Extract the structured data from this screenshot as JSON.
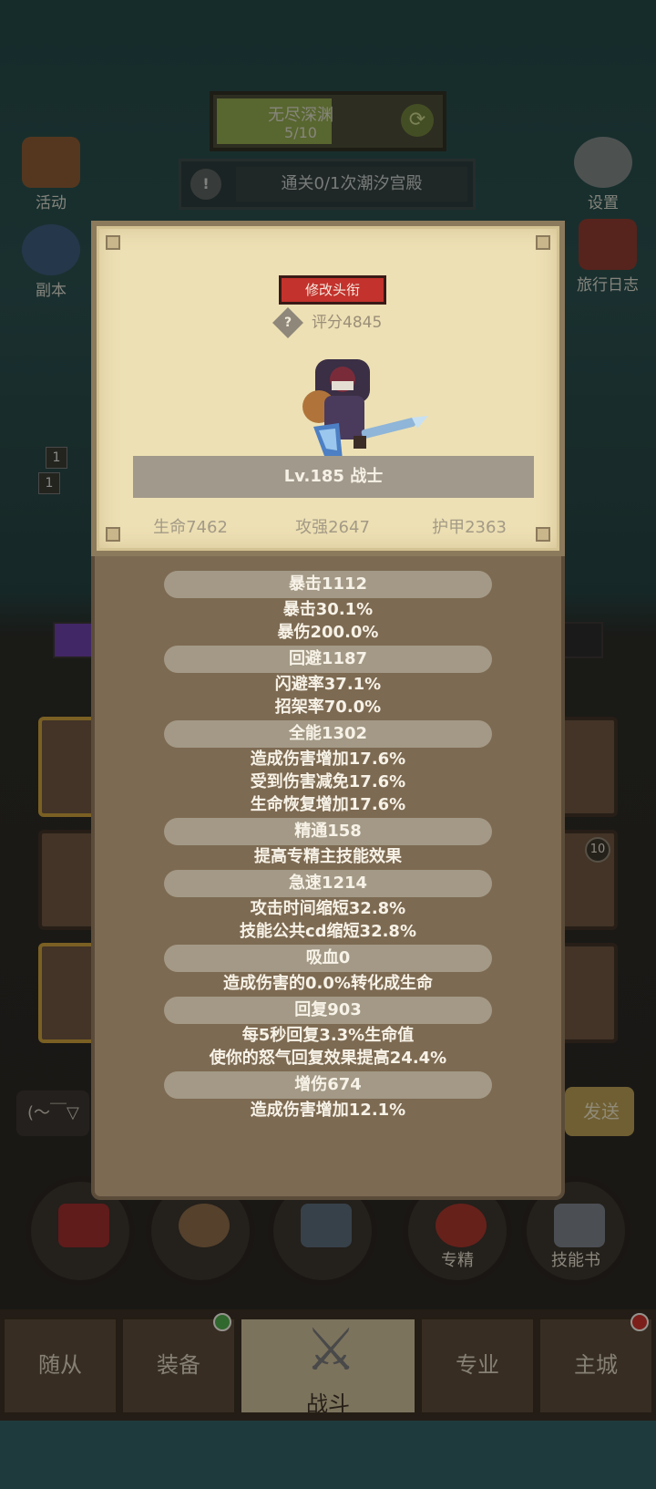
{
  "stage": {
    "name": "无尽深渊",
    "progress_text": "5/10",
    "progress_fraction": 0.5
  },
  "quest": {
    "text": "通关0/1次潮汐宫殿"
  },
  "left_icons": [
    "活动",
    "副本"
  ],
  "right_icons": [
    "设置",
    "旅行日志"
  ],
  "bg_levels": [
    "1",
    "1"
  ],
  "chat": {
    "emoticon": "(～￣▽"
  },
  "send_label": "发送",
  "slot_badge": "10",
  "circle_buttons": [
    {
      "label": ""
    },
    {
      "label": ""
    },
    {
      "label": ""
    },
    {
      "label": "专精"
    },
    {
      "label": "技能书"
    }
  ],
  "nav_tabs": [
    {
      "label": "随从",
      "active": false
    },
    {
      "label": "装备",
      "active": false
    },
    {
      "label": "战斗",
      "active": true
    },
    {
      "label": "专业",
      "active": false
    },
    {
      "label": "主城",
      "active": false
    }
  ],
  "profile": {
    "edit_title_label": "修改头衔",
    "score_text": "评分4845",
    "level_class": "Lv.185 战士",
    "hp": "生命7462",
    "attack": "攻强2647",
    "armor": "护甲2363"
  },
  "stats": {
    "crit": {
      "header": "暴击1112",
      "lines": [
        "暴击30.1%",
        "暴伤200.0%"
      ]
    },
    "dodge": {
      "header": "回避1187",
      "lines": [
        "闪避率37.1%",
        "招架率70.0%"
      ]
    },
    "versatility": {
      "header": "全能1302",
      "lines": [
        "造成伤害增加17.6%",
        "受到伤害减免17.6%",
        "生命恢复增加17.6%"
      ]
    },
    "mastery": {
      "header": "精通158",
      "lines": [
        "提高专精主技能效果"
      ]
    },
    "haste": {
      "header": "急速1214",
      "lines": [
        "攻击时间缩短32.8%",
        "技能公共cd缩短32.8%"
      ]
    },
    "leech": {
      "header": "吸血0",
      "lines": [
        "造成伤害的0.0%转化成生命"
      ]
    },
    "regen": {
      "header": "回复903",
      "lines": [
        "每5秒回复3.3%生命值",
        "使你的怒气回复效果提高24.4%"
      ]
    },
    "dmg_increase": {
      "header": "增伤674",
      "lines": [
        "造成伤害增加12.1%"
      ]
    }
  },
  "colors": {
    "title_button": "#c3322c",
    "paper": "#ede0b4",
    "panel": "#7d6a52",
    "dot_green": "#4fa84a",
    "dot_red": "#c9322c"
  }
}
